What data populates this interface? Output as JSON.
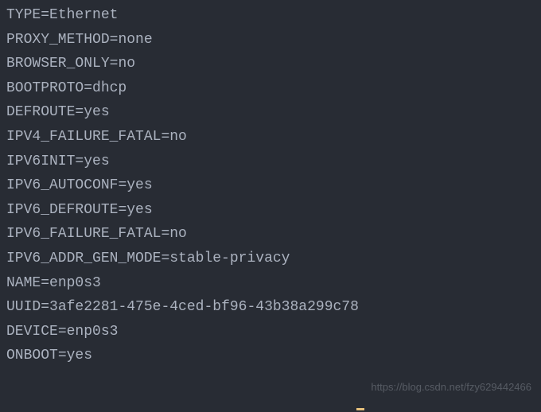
{
  "config_lines": [
    {
      "key": "TYPE",
      "value": "Ethernet"
    },
    {
      "key": "PROXY_METHOD",
      "value": "none"
    },
    {
      "key": "BROWSER_ONLY",
      "value": "no"
    },
    {
      "key": "BOOTPROTO",
      "value": "dhcp"
    },
    {
      "key": "DEFROUTE",
      "value": "yes"
    },
    {
      "key": "IPV4_FAILURE_FATAL",
      "value": "no"
    },
    {
      "key": "IPV6INIT",
      "value": "yes"
    },
    {
      "key": "IPV6_AUTOCONF",
      "value": "yes"
    },
    {
      "key": "IPV6_DEFROUTE",
      "value": "yes"
    },
    {
      "key": "IPV6_FAILURE_FATAL",
      "value": "no"
    },
    {
      "key": "IPV6_ADDR_GEN_MODE",
      "value": "stable-privacy"
    },
    {
      "key": "NAME",
      "value": "enp0s3"
    },
    {
      "key": "UUID",
      "value": "3afe2281-475e-4ced-bf96-43b38a299c78"
    },
    {
      "key": "DEVICE",
      "value": "enp0s3"
    },
    {
      "key": "ONBOOT",
      "value": "yes"
    }
  ],
  "watermark_text": "https://blog.csdn.net/fzy629442466"
}
